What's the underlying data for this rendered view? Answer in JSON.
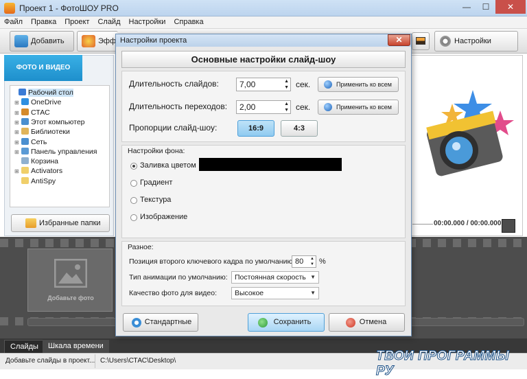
{
  "window": {
    "title": "Проект 1 - ФотоШОУ PRO",
    "minimize": "—",
    "maximize": "☐",
    "close": "✕"
  },
  "menu": [
    "Файл",
    "Правка",
    "Проект",
    "Слайд",
    "Настройки",
    "Справка"
  ],
  "toolbar": {
    "add_label": "Добавить",
    "effects_label": "Эфф",
    "project_settings_label": "Настройки проекта"
  },
  "left_panel": {
    "tab_label": "ФОТО И ВИДЕО",
    "tree": [
      {
        "label": "Рабочий стол",
        "expand": "",
        "color": "#3a7bd5"
      },
      {
        "label": "OneDrive",
        "expand": "⊞",
        "color": "#2f8fe0"
      },
      {
        "label": "СТАС",
        "expand": "⊞",
        "color": "#d48a2c"
      },
      {
        "label": "Этот компьютер",
        "expand": "⊞",
        "color": "#4a8fd0"
      },
      {
        "label": "Библиотеки",
        "expand": "⊞",
        "color": "#e0b45a"
      },
      {
        "label": "Сеть",
        "expand": "⊞",
        "color": "#4a8fd0"
      },
      {
        "label": "Панель управления",
        "expand": "⊞",
        "color": "#5a9ad5"
      },
      {
        "label": "Корзина",
        "expand": "",
        "color": "#8fb0cf"
      },
      {
        "label": "Activators",
        "expand": "⊞",
        "color": "#f0cf6a"
      },
      {
        "label": "AntiSpy",
        "expand": "",
        "color": "#f0cf6a"
      }
    ],
    "favorites_label": "Избранные папки"
  },
  "preview": {
    "timecode": "00:00.000 / 00:00.000"
  },
  "timeline": {
    "add_photo_label": "Добавьте фото"
  },
  "bottom_tabs": {
    "slides": "Слайды",
    "timeline": "Шкала времени"
  },
  "status": {
    "hint": "Добавьте слайды в проект...",
    "path": "C:\\Users\\СТАС\\Desktop\\"
  },
  "dialog": {
    "title": "Настройки проекта",
    "close": "✕",
    "header": "Основные настройки слайд-шоу",
    "slide_duration_label": "Длительность слайдов:",
    "slide_duration_value": "7,00",
    "transition_duration_label": "Длительность переходов:",
    "transition_duration_value": "2,00",
    "unit_sec": "сек.",
    "apply_all": "Применить ко всем",
    "aspect_label": "Пропорции слайд-шоу:",
    "aspect_options": [
      "16:9",
      "4:3"
    ],
    "aspect_selected": "16:9",
    "background_section": "Настройки фона:",
    "bg_options": [
      "Заливка цветом",
      "Градиент",
      "Текстура",
      "Изображение"
    ],
    "bg_selected": "Заливка цветом",
    "bg_color": "#000000",
    "misc_section": "Разное:",
    "keyframe_label": "Позиция второго ключевого кадра по умолчанию:",
    "keyframe_value": "80",
    "keyframe_unit": "%",
    "animation_label": "Тип анимации по умолчанию:",
    "animation_value": "Постоянная скорость",
    "quality_label": "Качество фото для видео:",
    "quality_value": "Высокое",
    "standard_button": "Стандартные",
    "save_button": "Сохранить",
    "cancel_button": "Отмена"
  },
  "watermark": "ТВОИ ПРОГРАММЫ РУ",
  "colors": {
    "accent_blue": "#1e8fcc",
    "save_green": "#3aa34a",
    "cancel_red": "#d43a2a"
  }
}
